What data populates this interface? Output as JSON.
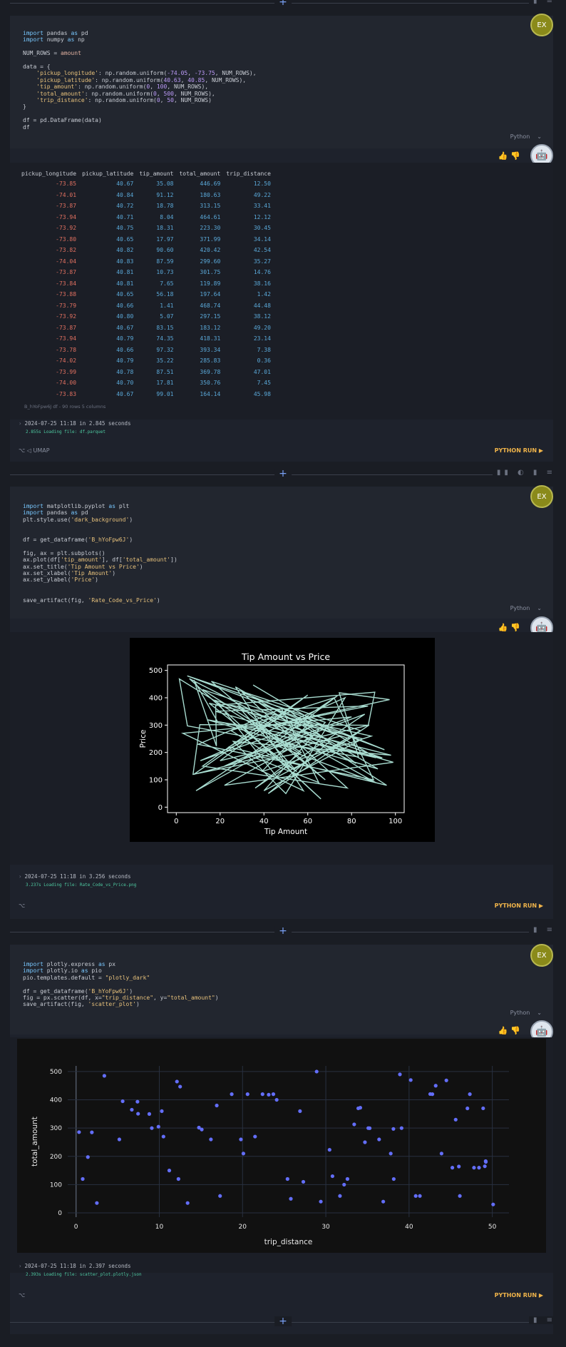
{
  "divider_tools": {
    "top": "▮ ≡",
    "d1": "▮▮ ◐ ▮ ≡",
    "d2": "▮ ≡",
    "d3": "▮ ≡",
    "plus": "+"
  },
  "cells": [
    {
      "avatar": "EX",
      "code": [
        [
          [
            "kw",
            "import"
          ],
          [
            "t",
            " pandas "
          ],
          [
            "kw",
            "as"
          ],
          [
            "t",
            " pd"
          ]
        ],
        [
          [
            "kw",
            "import"
          ],
          [
            "t",
            " numpy "
          ],
          [
            "kw",
            "as"
          ],
          [
            "t",
            " np"
          ]
        ],
        [
          [
            "t",
            ""
          ]
        ],
        [
          [
            "t",
            "NUM_ROWS = "
          ],
          [
            "var",
            "amount"
          ]
        ],
        [
          [
            "t",
            ""
          ]
        ],
        [
          [
            "t",
            "data = {"
          ]
        ],
        [
          [
            "t",
            "    "
          ],
          [
            "str",
            "'pickup_longitude'"
          ],
          [
            "t",
            ": np.random.uniform("
          ],
          [
            "num",
            "-74.05"
          ],
          [
            "t",
            ", "
          ],
          [
            "num",
            "-73.75"
          ],
          [
            "t",
            ", NUM_ROWS),"
          ]
        ],
        [
          [
            "t",
            "    "
          ],
          [
            "str",
            "'pickup_latitude'"
          ],
          [
            "t",
            ": np.random.uniform("
          ],
          [
            "num",
            "40.63"
          ],
          [
            "t",
            ", "
          ],
          [
            "num",
            "40.85"
          ],
          [
            "t",
            ", NUM_ROWS),"
          ]
        ],
        [
          [
            "t",
            "    "
          ],
          [
            "str",
            "'tip_amount'"
          ],
          [
            "t",
            ": np.random.uniform("
          ],
          [
            "num",
            "0"
          ],
          [
            "t",
            ", "
          ],
          [
            "num",
            "100"
          ],
          [
            "t",
            ", NUM_ROWS),"
          ]
        ],
        [
          [
            "t",
            "    "
          ],
          [
            "str",
            "'total_amount'"
          ],
          [
            "t",
            ": np.random.uniform("
          ],
          [
            "num",
            "0"
          ],
          [
            "t",
            ", "
          ],
          [
            "num",
            "500"
          ],
          [
            "t",
            ", NUM_ROWS),"
          ]
        ],
        [
          [
            "t",
            "    "
          ],
          [
            "str",
            "'trip_distance'"
          ],
          [
            "t",
            ": np.random.uniform("
          ],
          [
            "num",
            "0"
          ],
          [
            "t",
            ", "
          ],
          [
            "num",
            "50"
          ],
          [
            "t",
            ", NUM_ROWS)"
          ]
        ],
        [
          [
            "t",
            "}"
          ]
        ],
        [
          [
            "t",
            ""
          ]
        ],
        [
          [
            "t",
            "df = pd.DataFrame(data)"
          ]
        ],
        [
          [
            "t",
            "df"
          ]
        ]
      ],
      "language": "Python",
      "table": {
        "columns": [
          "pickup_longitude",
          "pickup_latitude",
          "tip_amount",
          "total_amount",
          "trip_distance"
        ],
        "rows": [
          [
            "-73.85",
            "40.67",
            "35.08",
            "446.69",
            "12.50"
          ],
          [
            "-74.01",
            "40.84",
            "91.12",
            "180.63",
            "49.22"
          ],
          [
            "-73.87",
            "40.72",
            "18.78",
            "313.15",
            "33.41"
          ],
          [
            "-73.94",
            "40.71",
            "8.04",
            "464.61",
            "12.12"
          ],
          [
            "-73.92",
            "40.75",
            "18.31",
            "223.30",
            "30.45"
          ],
          [
            "-73.80",
            "40.65",
            "17.97",
            "371.99",
            "34.14"
          ],
          [
            "-73.82",
            "40.82",
            "90.60",
            "420.42",
            "42.54"
          ],
          [
            "-74.04",
            "40.83",
            "87.59",
            "299.60",
            "35.27"
          ],
          [
            "-73.87",
            "40.81",
            "10.73",
            "301.75",
            "14.76"
          ],
          [
            "-73.84",
            "40.81",
            "7.65",
            "119.89",
            "38.16"
          ],
          [
            "-73.88",
            "40.65",
            "56.18",
            "197.64",
            "1.42"
          ],
          [
            "-73.79",
            "40.66",
            "1.41",
            "468.74",
            "44.48"
          ],
          [
            "-73.92",
            "40.80",
            "5.07",
            "297.15",
            "38.12"
          ],
          [
            "-73.87",
            "40.67",
            "83.15",
            "183.12",
            "49.20"
          ],
          [
            "-73.94",
            "40.79",
            "74.35",
            "418.31",
            "23.14"
          ],
          [
            "-73.78",
            "40.66",
            "97.32",
            "393.34",
            "7.38"
          ],
          [
            "-74.02",
            "40.79",
            "35.22",
            "285.83",
            "0.36"
          ],
          [
            "-73.99",
            "40.78",
            "87.51",
            "369.78",
            "47.01"
          ],
          [
            "-74.00",
            "40.70",
            "17.81",
            "350.76",
            "7.45"
          ],
          [
            "-73.83",
            "40.67",
            "99.01",
            "164.14",
            "45.98"
          ]
        ],
        "footer": "B_hYoFpw6J df - 90 rows 5 columns"
      },
      "runinfo": "2024-07-25 11:18 in 2.845 seconds",
      "loadinfo": "2.855s Loading file: df.parquet",
      "footer_left": "⌥   ◁ UMAP",
      "run_label": "PYTHON RUN ▶"
    },
    {
      "avatar": "EX",
      "code": [
        [
          [
            "kw",
            "import"
          ],
          [
            "t",
            " matplotlib.pyplot "
          ],
          [
            "kw",
            "as"
          ],
          [
            "t",
            " plt"
          ]
        ],
        [
          [
            "kw",
            "import"
          ],
          [
            "t",
            " pandas "
          ],
          [
            "kw",
            "as"
          ],
          [
            "t",
            " pd"
          ]
        ],
        [
          [
            "t",
            "plt.style.use("
          ],
          [
            "str",
            "'dark_background'"
          ],
          [
            "t",
            ")"
          ]
        ],
        [
          [
            "t",
            ""
          ]
        ],
        [
          [
            "t",
            ""
          ]
        ],
        [
          [
            "t",
            "df = get_dataframe("
          ],
          [
            "str",
            "'B_hYoFpw6J'"
          ],
          [
            "t",
            ")"
          ]
        ],
        [
          [
            "t",
            ""
          ]
        ],
        [
          [
            "t",
            "fig, ax = plt.subplots()"
          ]
        ],
        [
          [
            "t",
            "ax.plot(df["
          ],
          [
            "str",
            "'tip_amount'"
          ],
          [
            "t",
            "], df["
          ],
          [
            "str",
            "'total_amount'"
          ],
          [
            "t",
            "])"
          ]
        ],
        [
          [
            "t",
            "ax.set_title("
          ],
          [
            "str",
            "'Tip Amount vs Price'"
          ],
          [
            "t",
            ")"
          ]
        ],
        [
          [
            "t",
            "ax.set_xlabel("
          ],
          [
            "str",
            "'Tip Amount'"
          ],
          [
            "t",
            ")"
          ]
        ],
        [
          [
            "t",
            "ax.set_ylabel("
          ],
          [
            "str",
            "'Price'"
          ],
          [
            "t",
            ")"
          ]
        ],
        [
          [
            "t",
            ""
          ]
        ],
        [
          [
            "t",
            ""
          ]
        ],
        [
          [
            "t",
            "save_artifact(fig, "
          ],
          [
            "str",
            "'Rate_Code_vs_Price'"
          ],
          [
            "t",
            ")"
          ]
        ]
      ],
      "language": "Python",
      "runinfo": "2024-07-25 11:18 in 3.256 seconds",
      "loadinfo": "3.237s Loading file: Rate_Code_vs_Price.png",
      "footer_left": "⌥",
      "run_label": "PYTHON RUN ▶"
    },
    {
      "avatar": "EX",
      "code": [
        [
          [
            "kw",
            "import"
          ],
          [
            "t",
            " plotly.express "
          ],
          [
            "kw",
            "as"
          ],
          [
            "t",
            " px"
          ]
        ],
        [
          [
            "kw",
            "import"
          ],
          [
            "t",
            " plotly.io "
          ],
          [
            "kw",
            "as"
          ],
          [
            "t",
            " pio"
          ]
        ],
        [
          [
            "t",
            "pio.templates.default = "
          ],
          [
            "str",
            "\"plotly_dark\""
          ]
        ],
        [
          [
            "t",
            ""
          ]
        ],
        [
          [
            "t",
            "df = get_dataframe("
          ],
          [
            "str",
            "'B_hYoFpw6J'"
          ],
          [
            "t",
            ")"
          ]
        ],
        [
          [
            "t",
            "fig = px.scatter(df, x="
          ],
          [
            "str",
            "\"trip_distance\""
          ],
          [
            "t",
            ", y="
          ],
          [
            "str",
            "\"total_amount\""
          ],
          [
            "t",
            ")"
          ]
        ],
        [
          [
            "t",
            "save_artifact(fig, "
          ],
          [
            "str",
            "'scatter_plot'"
          ],
          [
            "t",
            ")"
          ]
        ]
      ],
      "language": "Python",
      "runinfo": "2024-07-25 11:18 in 2.397 seconds",
      "loadinfo": "2.393s Loading file: scatter_plot.plotly.json",
      "footer_left": "⌥",
      "run_label": "PYTHON RUN ▶"
    }
  ],
  "chart_data": [
    {
      "type": "line",
      "title": "Tip Amount vs Price",
      "xlabel": "Tip Amount",
      "ylabel": "Price",
      "xlim": [
        -4,
        104
      ],
      "ylim": [
        -20,
        520
      ],
      "xticks": [
        0,
        20,
        40,
        60,
        80,
        100
      ],
      "yticks": [
        0,
        100,
        200,
        300,
        400,
        500
      ],
      "color": "#a8dcd0",
      "x": [
        35.08,
        91.12,
        18.78,
        8.04,
        18.31,
        17.97,
        90.6,
        87.59,
        10.73,
        7.65,
        56.18,
        1.41,
        5.07,
        83.15,
        74.35,
        97.32,
        35.22,
        87.51,
        17.81,
        99.01,
        22,
        62,
        45,
        12,
        78,
        30,
        95,
        5,
        68,
        40,
        85,
        15,
        55,
        25,
        72,
        90,
        10,
        48,
        65,
        33,
        80,
        3,
        58,
        27,
        92,
        14,
        70,
        42,
        88,
        20,
        60,
        8,
        75,
        38,
        96,
        24,
        52,
        82,
        6,
        66,
        31,
        94,
        18,
        46,
        79,
        12,
        57,
        36,
        86,
        22,
        63,
        9,
        74,
        44,
        91,
        28,
        54,
        84,
        16,
        68,
        34,
        98,
        26,
        50,
        77,
        11,
        61,
        39,
        89,
        21
      ],
      "y": [
        446.69,
        180.63,
        313.15,
        464.61,
        223.3,
        371.99,
        420.42,
        299.6,
        301.75,
        119.89,
        197.64,
        468.74,
        297.15,
        183.12,
        418.31,
        393.34,
        285.83,
        369.78,
        350.76,
        164.14,
        80,
        260,
        340,
        150,
        70,
        420,
        210,
        480,
        310,
        60,
        250,
        380,
        130,
        280,
        400,
        100,
        230,
        360,
        90,
        190,
        330,
        270,
        60,
        440,
        140,
        320,
        240,
        50,
        300,
        170,
        410,
        120,
        260,
        380,
        80,
        220,
        350,
        160,
        470,
        30,
        290,
        180,
        390,
        110,
        250,
        430,
        200,
        70,
        340,
        150,
        300,
        60,
        410,
        230,
        90,
        370,
        140,
        280,
        460,
        100,
        320,
        190,
        240,
        50,
        400,
        170,
        310,
        130,
        260,
        380
      ]
    },
    {
      "type": "scatter",
      "xlabel": "trip_distance",
      "ylabel": "total_amount",
      "xlim": [
        -1,
        52
      ],
      "ylim": [
        -15,
        520
      ],
      "xticks": [
        0,
        10,
        20,
        30,
        40,
        50
      ],
      "yticks": [
        0,
        100,
        200,
        300,
        400,
        500
      ],
      "color": "#636efa",
      "x": [
        12.5,
        49.22,
        33.41,
        12.12,
        30.45,
        34.14,
        42.54,
        35.27,
        14.76,
        38.16,
        1.42,
        44.48,
        38.12,
        49.2,
        23.14,
        7.38,
        0.36,
        47.01,
        7.45,
        45.98,
        3.4,
        5.6,
        8.8,
        9.9,
        10.5,
        11.2,
        12.3,
        15.1,
        16.2,
        17.3,
        18.7,
        20.1,
        20.6,
        21.5,
        22.4,
        24.1,
        25.8,
        27.3,
        28.9,
        30.8,
        31.7,
        32.6,
        33.9,
        35.1,
        36.4,
        37.8,
        39.1,
        40.2,
        41.3,
        42.8,
        43.9,
        45.2,
        46.1,
        47.3,
        48.4,
        49.1,
        50.1,
        0.8,
        1.9,
        2.5,
        5.2,
        6.7,
        9.1,
        13.4,
        16.9,
        19.8,
        23.7,
        26.9,
        29.4,
        32.2,
        34.7,
        36.9,
        38.9,
        40.8,
        43.2,
        45.6,
        47.8,
        48.9,
        10.3,
        25.4
      ],
      "y": [
        446.69,
        180.63,
        313.15,
        464.61,
        223.3,
        371.99,
        420.42,
        299.6,
        301.75,
        119.89,
        197.64,
        468.74,
        297.15,
        183.12,
        418.31,
        393.34,
        285.83,
        369.78,
        350.76,
        164.14,
        485,
        395,
        350,
        305,
        270,
        150,
        120,
        295,
        260,
        60,
        420,
        210,
        420,
        270,
        420,
        400,
        50,
        110,
        500,
        130,
        60,
        120,
        370,
        300,
        260,
        210,
        300,
        470,
        60,
        420,
        210,
        160,
        60,
        420,
        160,
        165,
        30,
        120,
        285,
        35,
        260,
        365,
        300,
        35,
        380,
        260,
        420,
        360,
        40,
        100,
        250,
        40,
        490,
        60,
        450,
        330,
        160,
        370,
        360,
        120
      ],
      "dots_extra": []
    }
  ]
}
